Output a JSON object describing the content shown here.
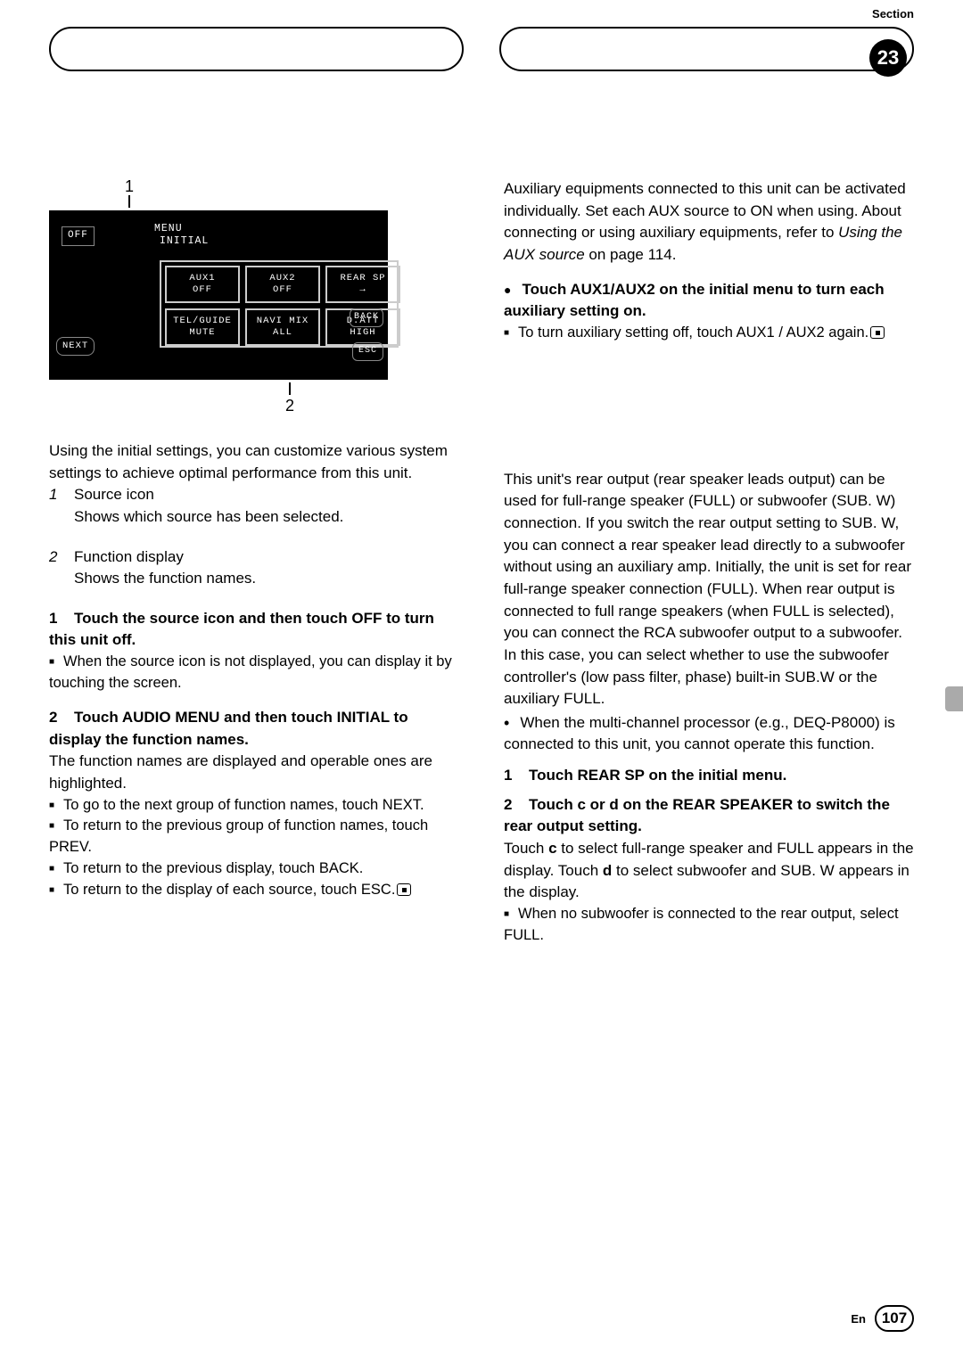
{
  "header": {
    "section_label": "Section",
    "badge": "23"
  },
  "footer": {
    "lang": "En",
    "page": "107"
  },
  "pointer_top": "1",
  "pointer_bot": "2",
  "ss": {
    "off": "OFF",
    "menu1": "MENU",
    "menu2": "INITIAL",
    "cells": {
      "aux1_t": "AUX1",
      "aux1_b": "OFF",
      "aux2_t": "AUX2",
      "aux2_b": "OFF",
      "rear_t": "REAR SP",
      "rear_b": "→",
      "tel_t": "TEL/GUIDE",
      "tel_b": "MUTE",
      "navi_t": "NAVI MIX",
      "navi_b": "ALL",
      "datt_t": "D.ATT",
      "datt_b": "HIGH"
    },
    "next": "NEXT",
    "back": "BACK",
    "esc": "ESC"
  },
  "left": {
    "intro": "Using the initial settings, you can customize various system settings to achieve optimal performance from this unit.",
    "i1_num": "1",
    "i1_title": "Source icon",
    "i1_desc": "Shows which source has been selected.",
    "i2_num": "2",
    "i2_title": "Function display",
    "i2_desc": "Shows the function names.",
    "s1_num": "1",
    "s1_title": "Touch the source icon and then touch OFF to turn this unit off.",
    "s1_note": "When the source icon is not displayed, you can display it by touching the screen.",
    "s2_num": "2",
    "s2_title": "Touch AUDIO MENU and then touch INITIAL to display the function names.",
    "s2_body": "The function names are displayed and operable ones are highlighted.",
    "s2_n1": "To go to the next group of function names, touch NEXT.",
    "s2_n2": "To return to the previous group of function names, touch PREV.",
    "s2_n3": "To return to the previous display, touch BACK.",
    "s2_n4_a": "To return to the display of each source, touch ESC."
  },
  "right": {
    "aux_intro_a": "Auxiliary equipments connected to this unit can be activated individually. Set each AUX source to ON when using. About connecting or using auxiliary equipments, refer to ",
    "aux_intro_i": "Using the AUX source",
    "aux_intro_b": " on page 114.",
    "aux_step_t": "Touch AUX1/AUX2 on the initial menu to turn each auxiliary setting on.",
    "aux_note": "To turn auxiliary setting off, touch AUX1 / AUX2 again.",
    "rear_body": "This unit's rear output (rear speaker leads output) can be used for full-range speaker (FULL) or subwoofer (SUB. W) connection. If you switch the rear output setting to SUB. W, you can connect a rear speaker lead directly to a subwoofer without using an auxiliary amp. Initially, the unit is set for rear full-range speaker connection (FULL). When rear output is connected to full range speakers (when FULL is selected), you can connect the RCA subwoofer output to a subwoofer. In this case, you can select whether to use the subwoofer controller's (low pass filter, phase) built-in SUB.W or the auxiliary FULL.",
    "rear_bullet": "When the multi-channel processor (e.g., DEQ-P8000) is connected to this unit, you cannot operate this function.",
    "rs1_num": "1",
    "rs1_title": "Touch REAR SP on the initial menu.",
    "rs2_num": "2",
    "rs2_a": "Touch ",
    "rs2_c": "c",
    "rs2_b": " or ",
    "rs2_d": "d",
    "rs2_e": " on the REAR SPEAKER to switch the rear output setting.",
    "rs2_body_a": "Touch ",
    "rs2_body_b": " to select full-range speaker and FULL appears in the display. Touch ",
    "rs2_body_c": " to select subwoofer and SUB. W appears in the display.",
    "rs2_note": "When no subwoofer is connected to the rear output, select FULL."
  }
}
